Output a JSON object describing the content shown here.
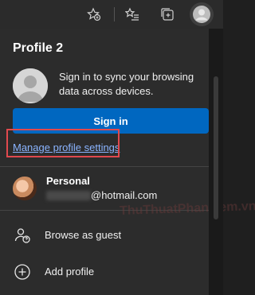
{
  "toolbar": {
    "icons": [
      "favorite-add-icon",
      "favorites-icon",
      "collections-icon",
      "profile-icon"
    ]
  },
  "profile": {
    "name": "Profile 2",
    "sync_text": "Sign in to sync your browsing data across devices.",
    "signin_label": "Sign in",
    "manage_link": "Manage profile settings"
  },
  "accounts": [
    {
      "name": "Personal",
      "email": "@hotmail.com"
    }
  ],
  "menu": [
    {
      "label": "Browse as guest",
      "icon": "guest-icon"
    },
    {
      "label": "Add profile",
      "icon": "add-profile-icon"
    }
  ],
  "watermark": "ThuThuatPhanMem.vn",
  "colors": {
    "accent": "#0067c0",
    "link": "#8ab4ff",
    "highlight": "#e0494e",
    "panel": "#2c2c2c"
  }
}
